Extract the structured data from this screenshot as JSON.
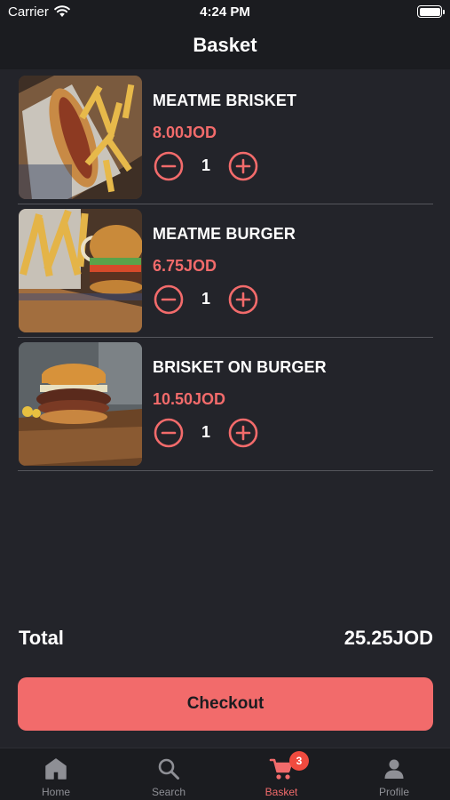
{
  "status_bar": {
    "carrier": "Carrier",
    "time": "4:24 PM"
  },
  "header": {
    "title": "Basket"
  },
  "items": [
    {
      "name": "MEATME BRISKET",
      "price": "8.00JOD",
      "quantity": "1",
      "image": "brisket-hotdog-fries"
    },
    {
      "name": "MEATME BURGER",
      "price": "6.75JOD",
      "quantity": "1",
      "image": "burger-with-fries"
    },
    {
      "name": "BRISKET ON BURGER",
      "price": "10.50JOD",
      "quantity": "1",
      "image": "brisket-burger-on-board"
    }
  ],
  "total": {
    "label": "Total",
    "value": "25.25JOD"
  },
  "checkout": {
    "label": "Checkout"
  },
  "tabs": [
    {
      "label": "Home",
      "icon": "home-icon"
    },
    {
      "label": "Search",
      "icon": "search-icon"
    },
    {
      "label": "Basket",
      "icon": "cart-icon",
      "badge": "3",
      "active": true
    },
    {
      "label": "Profile",
      "icon": "person-icon"
    }
  ],
  "colors": {
    "accent": "#f26b6b",
    "background": "#23242a",
    "bar": "#1b1c20",
    "badge": "#f04b3f"
  }
}
